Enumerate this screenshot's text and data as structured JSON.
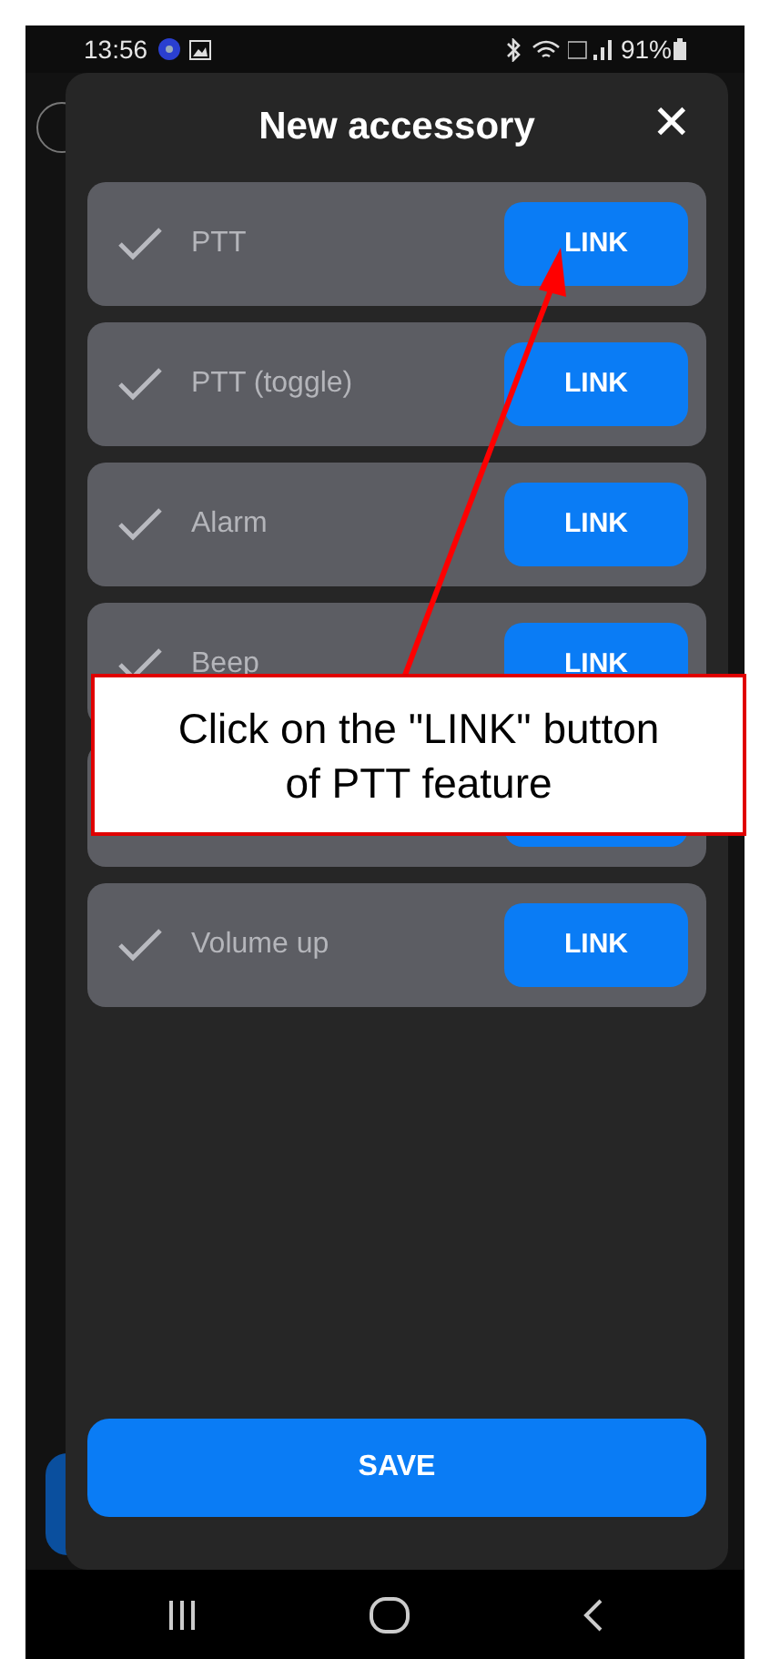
{
  "status_bar": {
    "time": "13:56",
    "battery": "91%"
  },
  "dialog": {
    "title": "New accessory",
    "close": "✕"
  },
  "features": [
    {
      "label": "PTT",
      "checked": true,
      "button": "LINK"
    },
    {
      "label": "PTT (toggle)",
      "checked": true,
      "button": "LINK"
    },
    {
      "label": "Alarm",
      "checked": true,
      "button": "LINK"
    },
    {
      "label": "Beep",
      "checked": true,
      "button": "LINK"
    },
    {
      "covered": true
    },
    {
      "label": "Volume up",
      "checked": true,
      "button": "LINK"
    }
  ],
  "save_button": "SAVE",
  "callout": {
    "text": "Click on the \"LINK\" button of PTT feature"
  }
}
